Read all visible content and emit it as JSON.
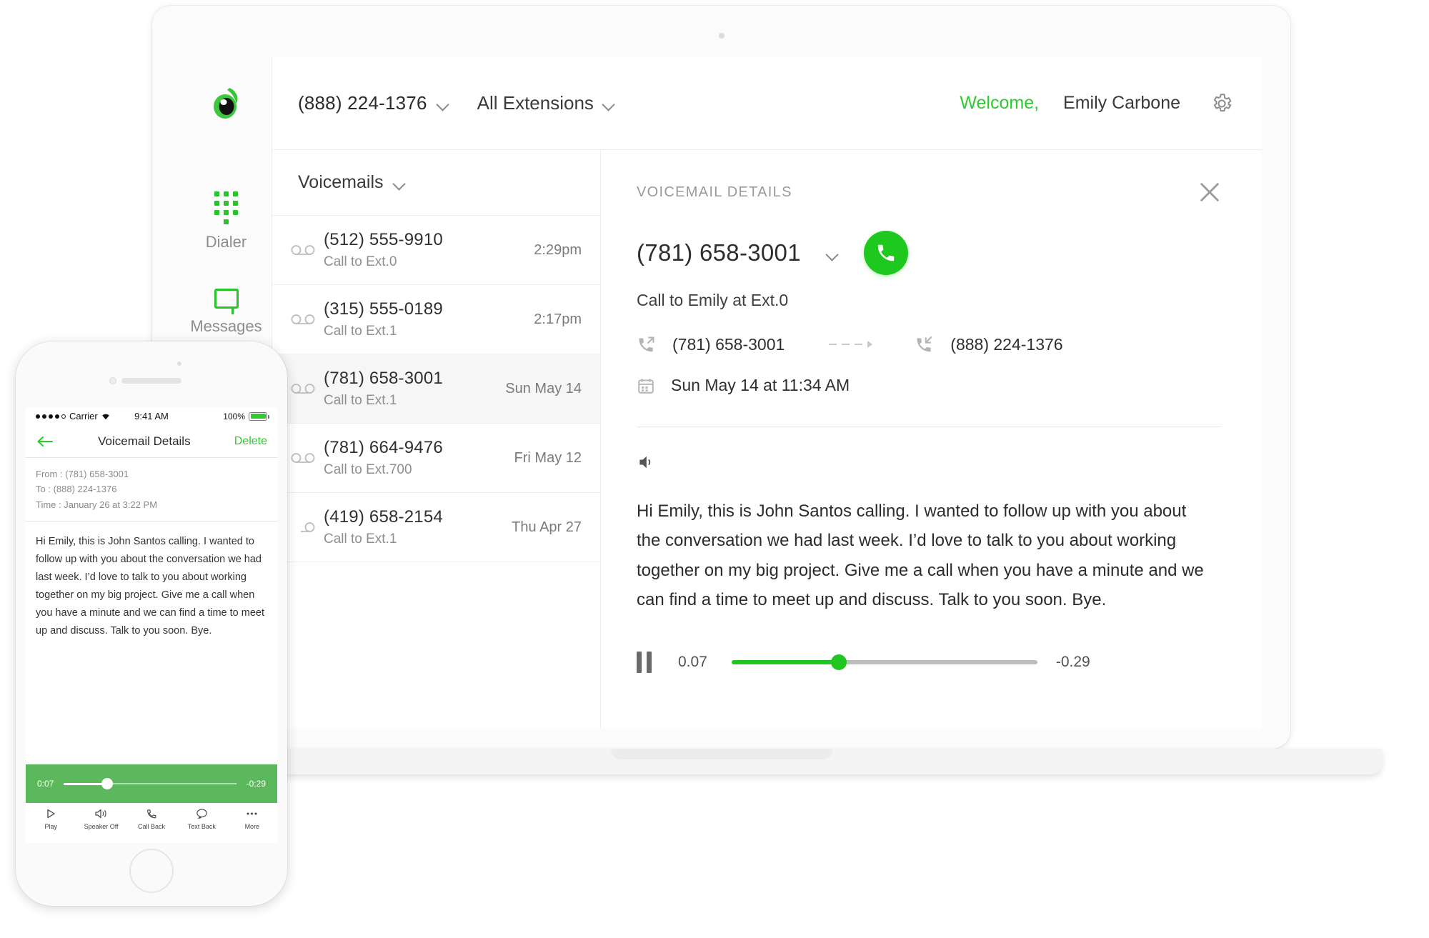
{
  "app": {
    "logo_icon": "green-eye-logo",
    "header": {
      "phone_number": "(888) 224-1376",
      "extensions_label": "All Extensions",
      "welcome_label": "Welcome,",
      "user_name": "Emily Carbone",
      "settings_icon": "gear-icon"
    },
    "sidebar": {
      "items": [
        {
          "label": "Dialer",
          "icon": "dialpad-icon"
        },
        {
          "label": "Messages",
          "icon": "message-bubble-icon"
        }
      ]
    },
    "list": {
      "title": "Voicemails",
      "rows": [
        {
          "number": "(512) 555-9910",
          "subtitle": "Call to Ext.0",
          "time": "2:29pm",
          "icon": "voicemail-icon",
          "selected": false
        },
        {
          "number": "(315) 555-0189",
          "subtitle": "Call to Ext.1",
          "time": "2:17pm",
          "icon": "voicemail-icon",
          "selected": false
        },
        {
          "number": "(781) 658-3001",
          "subtitle": "Call to Ext.1",
          "time": "Sun May 14",
          "icon": "voicemail-icon",
          "selected": true
        },
        {
          "number": "(781) 664-9476",
          "subtitle": "Call to Ext.700",
          "time": "Fri May 12",
          "icon": "voicemail-icon",
          "selected": false
        },
        {
          "number": "(419) 658-2154",
          "subtitle": "Call to Ext.1",
          "time": "Thu Apr 27",
          "icon": "voicemail-icon",
          "selected": false
        }
      ]
    },
    "details": {
      "title": "VOICEMAIL DETAILS",
      "close_icon": "close-icon",
      "number": "(781) 658-3001",
      "call_button_icon": "phone-icon",
      "subtitle": "Call to Emily at Ext.0",
      "from_number": "(781) 658-3001",
      "from_icon": "outgoing-call-icon",
      "to_number": "(888) 224-1376",
      "to_icon": "incoming-call-icon",
      "date_icon": "calendar-icon",
      "date": "Sun May 14 at 11:34 AM",
      "speaker_icon": "speaker-icon",
      "transcript": "Hi Emily, this is John Santos calling. I wanted to follow up with you about the conversation we had last week. I’d love to talk to you about working together on my big project. Give me a call when you have a minute and we can find a time to meet up and discuss. Talk to you soon. Bye.",
      "player": {
        "pause_icon": "pause-icon",
        "elapsed": "0.07",
        "remaining": "-0.29",
        "progress_percent": 35
      }
    }
  },
  "phone": {
    "status_bar": {
      "carrier": "Carrier",
      "time": "9:41 AM",
      "battery": "100%"
    },
    "navbar": {
      "back_icon": "back-arrow-icon",
      "title": "Voicemail Details",
      "delete_label": "Delete"
    },
    "meta": {
      "from": "From : (781) 658-3001",
      "to": "To : (888) 224-1376",
      "time": "Time : January 26 at 3:22 PM"
    },
    "transcript": "Hi Emily, this is John Santos calling. I wanted to follow up with you about the conversation we had last week. I’d love to talk to you about working together on my big project. Give me a call when you have a minute and we can find a time to meet up and discuss. Talk to you soon. Bye.",
    "player": {
      "elapsed": "0:07",
      "remaining": "-0:29",
      "progress_percent": 25
    },
    "toolbar": [
      {
        "label": "Play",
        "icon": "play-icon"
      },
      {
        "label": "Speaker Off",
        "icon": "speaker-off-icon"
      },
      {
        "label": "Call Back",
        "icon": "phone-icon"
      },
      {
        "label": "Text Back",
        "icon": "message-bubble-icon"
      },
      {
        "label": "More",
        "icon": "more-dots-icon"
      }
    ]
  },
  "colors": {
    "brand_green": "#29c429",
    "accent_green": "#20c520",
    "phone_player_green": "#5cb85c",
    "text_dark": "#2c2c2c",
    "text_muted": "#8f8f8f"
  }
}
